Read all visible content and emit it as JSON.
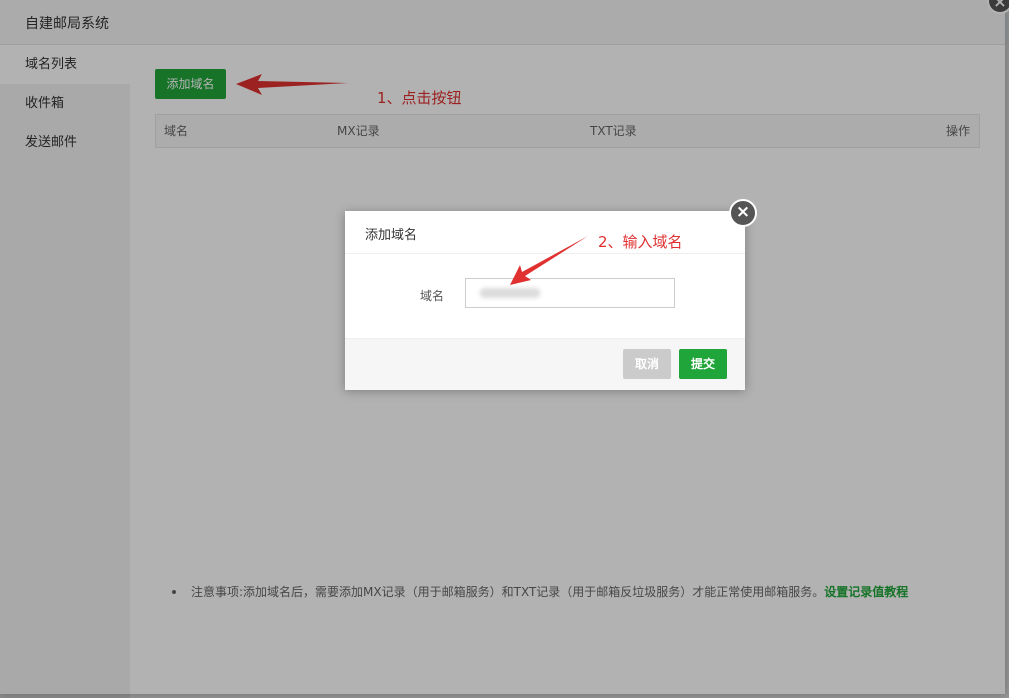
{
  "window": {
    "title": "自建邮局系统"
  },
  "sidebar": {
    "items": [
      {
        "label": "域名列表",
        "active": true
      },
      {
        "label": "收件箱",
        "active": false
      },
      {
        "label": "发送邮件",
        "active": false
      }
    ]
  },
  "toolbar": {
    "add_domain_label": "添加域名"
  },
  "table": {
    "columns": [
      "域名",
      "MX记录",
      "TXT记录",
      "操作"
    ]
  },
  "note": {
    "text": "注意事项:添加域名后，需要添加MX记录（用于邮箱服务）和TXT记录（用于邮箱反垃圾服务）才能正常使用邮箱服务。",
    "link": "设置记录值教程"
  },
  "modal": {
    "title": "添加域名",
    "field_label": "域名",
    "field_value": "",
    "cancel_label": "取消",
    "submit_label": "提交"
  },
  "annotations": {
    "step1": "1、点击按钮",
    "step2": "2、输入域名"
  },
  "colors": {
    "accent": "#20a53a",
    "annotation": "#e03030"
  }
}
